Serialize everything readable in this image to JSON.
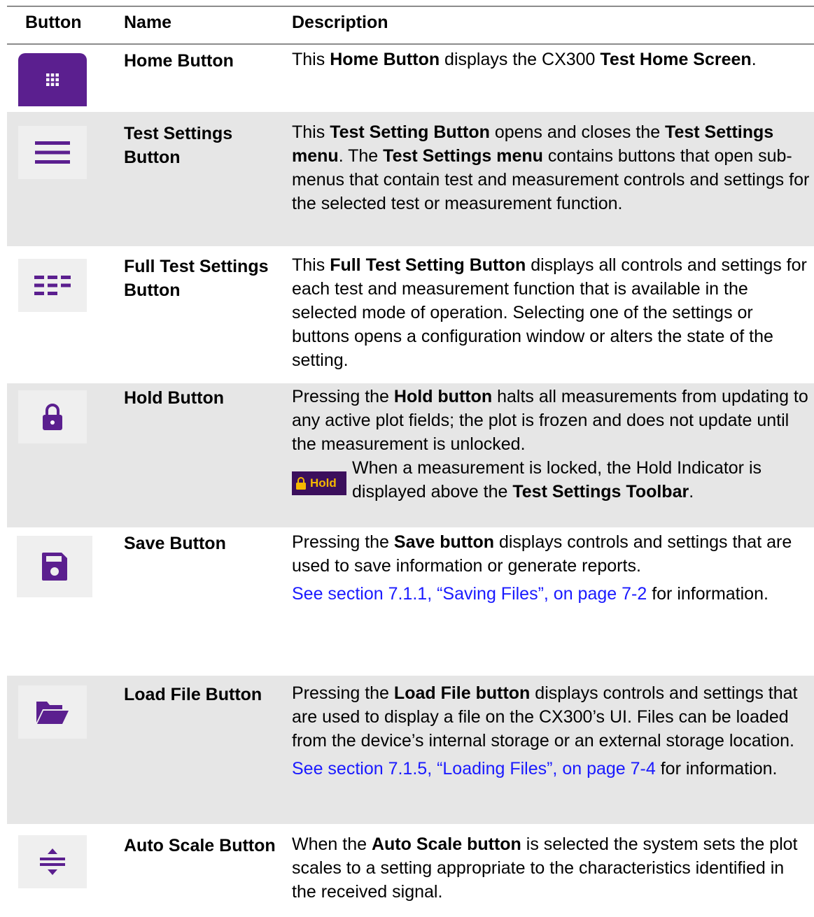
{
  "header": {
    "button": "Button",
    "name": "Name",
    "description": "Description"
  },
  "rows": [
    {
      "icon": "grid-icon",
      "name": "Home Button",
      "desc": {
        "p1": "This ",
        "b1": "Home Button",
        "p2": " displays the CX300 ",
        "b2": "Test Home Screen",
        "p3": "."
      }
    },
    {
      "icon": "menu-icon",
      "name": "Test Settings Button",
      "desc": {
        "p1": "This ",
        "b1": "Test Setting Button",
        "p2": " opens and closes the ",
        "b2": "Test Settings menu",
        "p3": ". The ",
        "b3": "Test Settings menu",
        "p4": " contains buttons that open sub-menus that contain test and measurement controls and settings for the selected test or measurement function."
      }
    },
    {
      "icon": "full-settings-icon",
      "name": "Full Test Settings Button",
      "desc": {
        "p1": "This ",
        "b1": "Full Test Setting Button",
        "p2": " displays all controls and settings for each test and measurement function that is available in the selected mode of operation. Selecting one of the settings or buttons opens a configuration window or alters the state of the setting."
      }
    },
    {
      "icon": "lock-icon",
      "name": "Hold Button",
      "desc": {
        "p1": "Pressing the ",
        "b1": "Hold button",
        "p2": " halts all measurements from updating to any active plot fields; the plot is frozen and does not update until the measurement is unlocked."
      },
      "hold_indicator": {
        "label": "Hold",
        "text1": "When a measurement is locked, the Hold Indicator is displayed above the ",
        "bold": "Test Settings Toolbar",
        "text2": "."
      }
    },
    {
      "icon": "floppy-disk-icon",
      "name": "Save Button",
      "desc": {
        "p1": "Pressing the ",
        "b1": "Save button",
        "p2": " displays controls and settings that are used to save information or generate reports."
      },
      "link": {
        "text": "See section 7.1.1, “Saving Files”, on page 7-2",
        "after": " for information."
      }
    },
    {
      "icon": "folder-open-icon",
      "name": "Load File Button",
      "desc": {
        "p1": "Pressing the ",
        "b1": "Load File button",
        "p2": " displays controls and settings that are used to display a file on the CX300’s UI. Files can be loaded from the device’s internal storage or an external storage location."
      },
      "link": {
        "text": "See section 7.1.5, “Loading Files”, on page 7-4",
        "after": " for information."
      }
    },
    {
      "icon": "auto-scale-icon",
      "name": "Auto Scale Button",
      "desc": {
        "p1": "When the ",
        "b1": "Auto Scale button",
        "p2": " is selected the system sets the plot scales to a setting appropriate to the characteristics identified in the received signal."
      }
    }
  ],
  "colors": {
    "purple": "#5b1f8f",
    "shade": "#e6e6e6",
    "link": "#1a1aff",
    "hold_gold": "#f5b800"
  }
}
